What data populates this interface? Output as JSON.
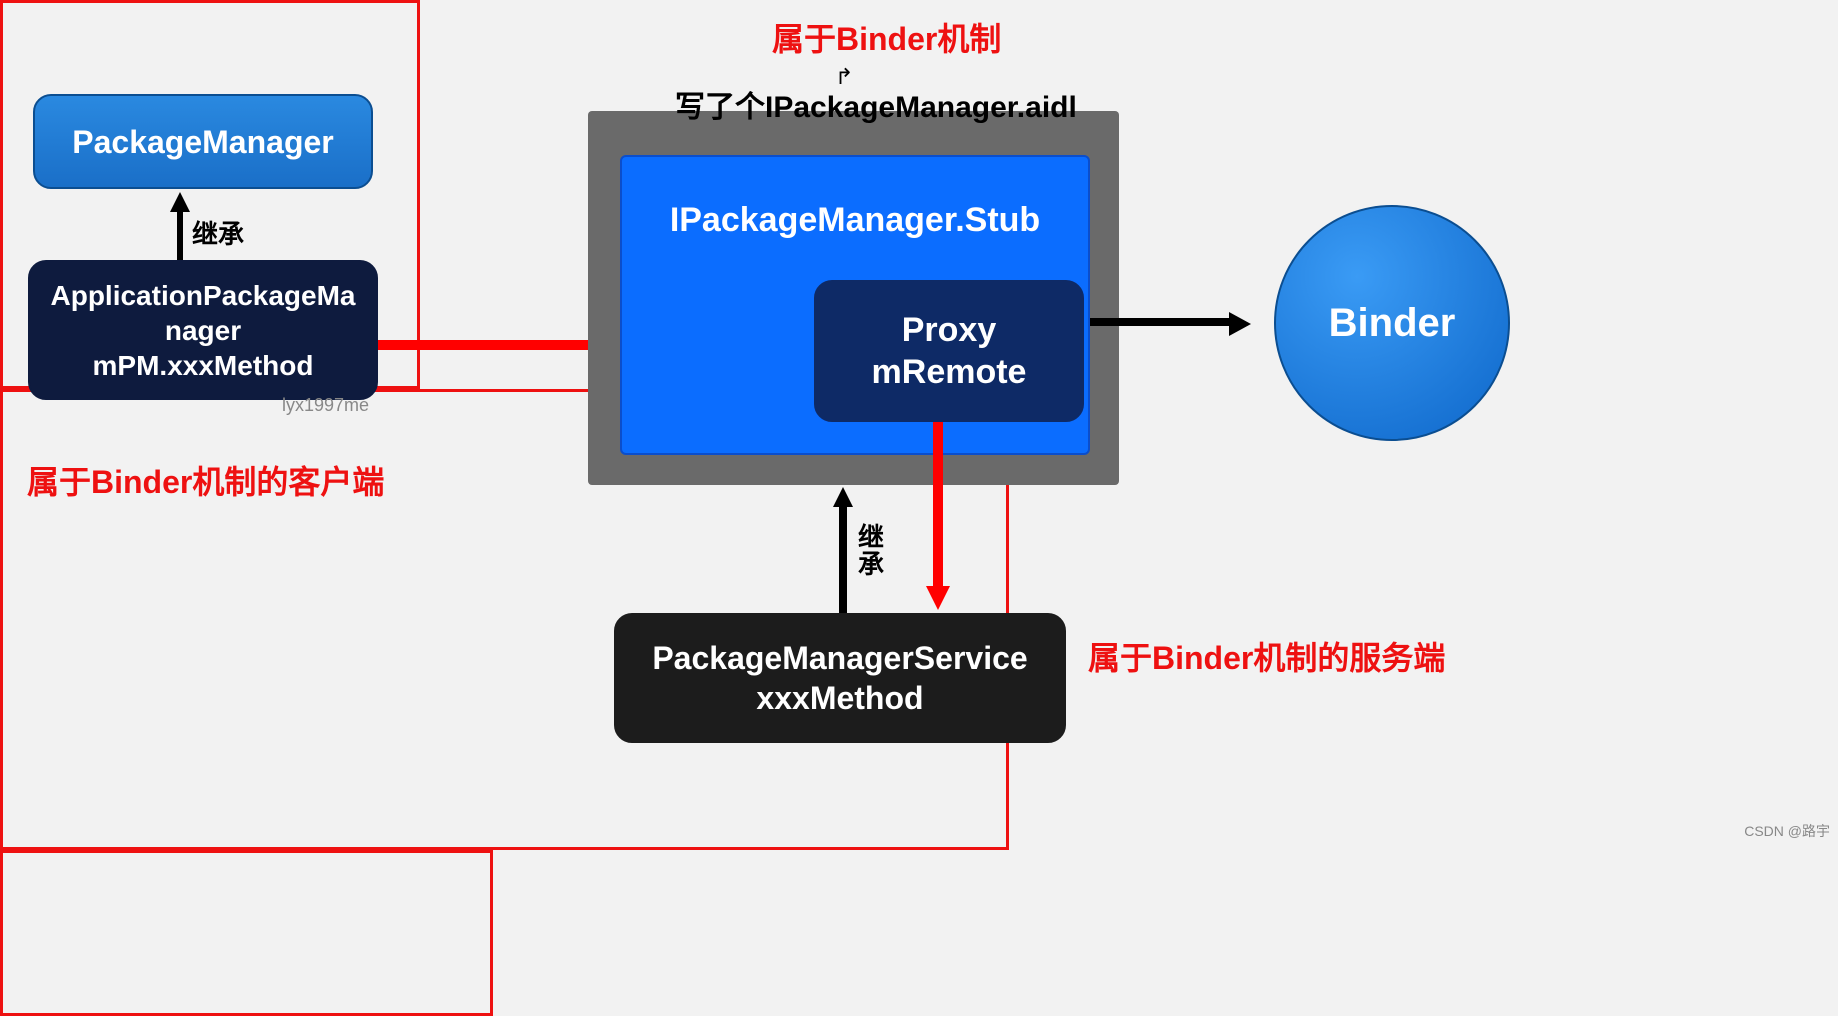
{
  "annotations": {
    "top_center": "属于Binder机制",
    "left_caption": "属于Binder机制的客户端",
    "right_caption": "属于Binder机制的服务端",
    "aidl_title": "写了个IPackageManager.aidl",
    "inherit_left": "继承",
    "inherit_bottom_line1": "继",
    "inherit_bottom_line2": "承"
  },
  "nodes": {
    "package_manager": "PackageManager",
    "app_pm_line1": "ApplicationPackageMa",
    "app_pm_line2": "nager",
    "app_pm_line3": "mPM.xxxMethod",
    "stub_title": "IPackageManager.Stub",
    "proxy_line1": "Proxy",
    "proxy_line2": "mRemote",
    "pms_line1": "PackageManagerService",
    "pms_line2": "xxxMethod",
    "binder": "Binder"
  },
  "meta": {
    "watermark": "lyx1997me",
    "footer": "CSDN @路宇"
  }
}
